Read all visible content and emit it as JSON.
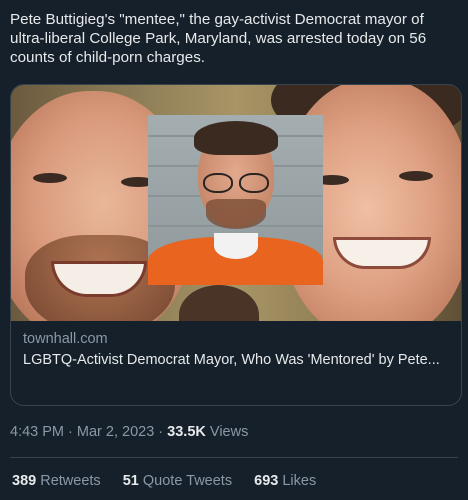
{
  "tweet": {
    "text": "Pete Buttigieg's \"mentee,\"  the gay-activist Democrat mayor of ultra-liberal College Park, Maryland, was arrested today on 56 counts of child-porn charges."
  },
  "link_card": {
    "domain": "townhall.com",
    "title": "LGBTQ-Activist Democrat Mayor, Who Was 'Mentored' by Pete..."
  },
  "meta": {
    "time": "4:43 PM",
    "separator": " · ",
    "date": "Mar 2, 2023",
    "views_count": "33.5K",
    "views_label": " Views"
  },
  "stats": {
    "retweets_count": "389",
    "retweets_label": " Retweets",
    "quotes_count": "51",
    "quotes_label": " Quote Tweets",
    "likes_count": "693",
    "likes_label": " Likes"
  },
  "colors": {
    "background": "#15202b",
    "text_primary": "#e7e9ea",
    "text_secondary": "#8b98a5",
    "border": "#38444d"
  }
}
